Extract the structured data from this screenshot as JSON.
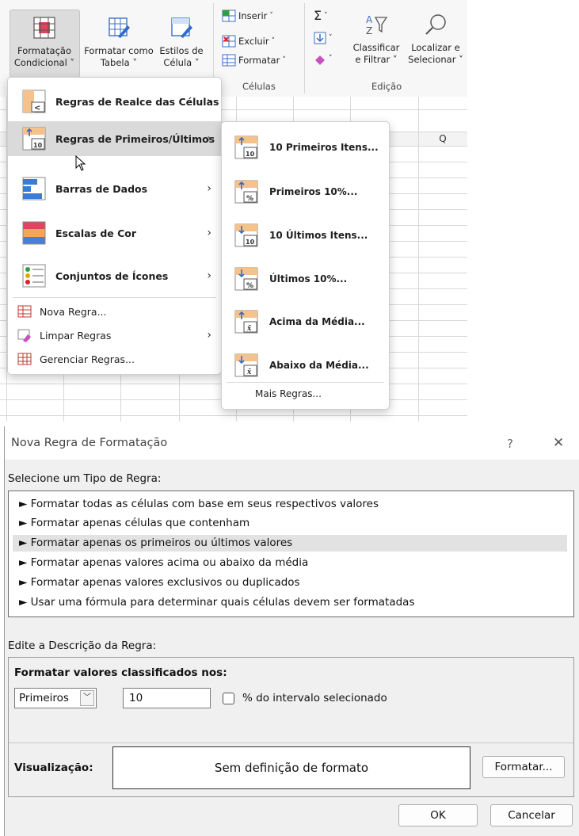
{
  "ribbon": {
    "buttons": [
      {
        "line1": "Formatação",
        "line2": "Condicional ˅"
      },
      {
        "line1": "Formatar como",
        "line2": "Tabela ˅"
      },
      {
        "line1": "Estilos de",
        "line2": "Célula ˅"
      }
    ],
    "cells_group": {
      "insert": "Inserir",
      "delete": "Excluir",
      "format": "Formatar",
      "label": "Células"
    },
    "edit_group": {
      "sort_line1": "Classificar",
      "sort_line2": "e Filtrar ˅",
      "find_line1": "Localizar e",
      "find_line2": "Selecionar ˅",
      "label": "Edição"
    }
  },
  "grid": {
    "column_q": "Q"
  },
  "main_menu": {
    "items": [
      {
        "label": "Regras de Realce das Células"
      },
      {
        "label": "Regras de Primeiros/Últimos"
      },
      {
        "label": "Barras de Dados"
      },
      {
        "label": "Escalas de Cor"
      },
      {
        "label": "Conjuntos de Ícones"
      }
    ],
    "small_items": [
      {
        "label": "Nova Regra..."
      },
      {
        "label": "Limpar Regras"
      },
      {
        "label": "Gerenciar Regras..."
      }
    ]
  },
  "sub_menu": {
    "items": [
      {
        "label": "10 Primeiros Itens..."
      },
      {
        "label": "Primeiros 10%..."
      },
      {
        "label": "10 Últimos Itens..."
      },
      {
        "label": "Últimos 10%..."
      },
      {
        "label": "Acima da Média..."
      },
      {
        "label": "Abaixo da Média..."
      }
    ],
    "more": "Mais Regras..."
  },
  "dialog": {
    "title": "Nova Regra de Formatação",
    "help": "?",
    "close": "✕",
    "select_label": "Selecione um Tipo de Regra:",
    "rule_types": [
      "► Formatar todas as células com base em seus respectivos valores",
      "► Formatar apenas células que contenham",
      "► Formatar apenas os primeiros ou últimos valores",
      "► Formatar apenas valores acima ou abaixo da média",
      "► Formatar apenas valores exclusivos ou duplicados",
      "► Usar uma fórmula para determinar quais células devem ser formatadas"
    ],
    "edit_label": "Edite a Descrição da Regra:",
    "format_ranked_label": "Formatar valores classificados nos:",
    "dropdown_value": "Primeiros",
    "number_value": "10",
    "percent_label": "% do intervalo selecionado",
    "preview_label": "Visualização:",
    "preview_text": "Sem definição de formato",
    "format_button": "Formatar...",
    "ok": "OK",
    "cancel": "Cancelar"
  }
}
